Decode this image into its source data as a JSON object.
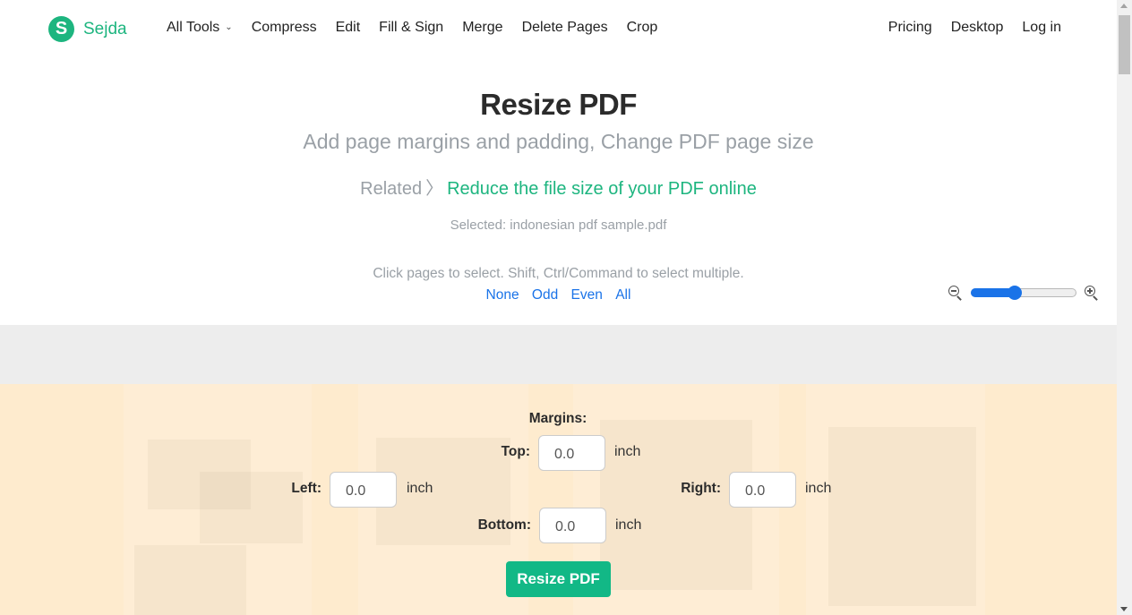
{
  "header": {
    "logo_letter": "S",
    "brand": "Sejda",
    "nav": [
      "All Tools",
      "Compress",
      "Edit",
      "Fill & Sign",
      "Merge",
      "Delete Pages",
      "Crop"
    ],
    "nav_right": [
      "Pricing",
      "Desktop",
      "Log in"
    ]
  },
  "hero": {
    "title": "Resize PDF",
    "subtitle": "Add page margins and padding, Change PDF page size",
    "related_label": "Related",
    "related_link": "Reduce the file size of your PDF online",
    "selected_file": "Selected: indonesian pdf sample.pdf"
  },
  "selection": {
    "hint": "Click pages to select. Shift, Ctrl/Command to select multiple.",
    "links": [
      "None",
      "Odd",
      "Even",
      "All"
    ]
  },
  "zoom": {
    "value_fraction": 0.4
  },
  "margins": {
    "title": "Margins:",
    "top": {
      "label": "Top:",
      "value": "0.0",
      "unit": "inch"
    },
    "left": {
      "label": "Left:",
      "value": "0.0",
      "unit": "inch"
    },
    "right": {
      "label": "Right:",
      "value": "0.0",
      "unit": "inch"
    },
    "bottom": {
      "label": "Bottom:",
      "value": "0.0",
      "unit": "inch"
    },
    "submit_label": "Resize PDF"
  },
  "colors": {
    "brand_green": "#1db57f",
    "button_green": "#12b886",
    "link_blue": "#1a73e8",
    "panel_bg": "#feebce"
  }
}
